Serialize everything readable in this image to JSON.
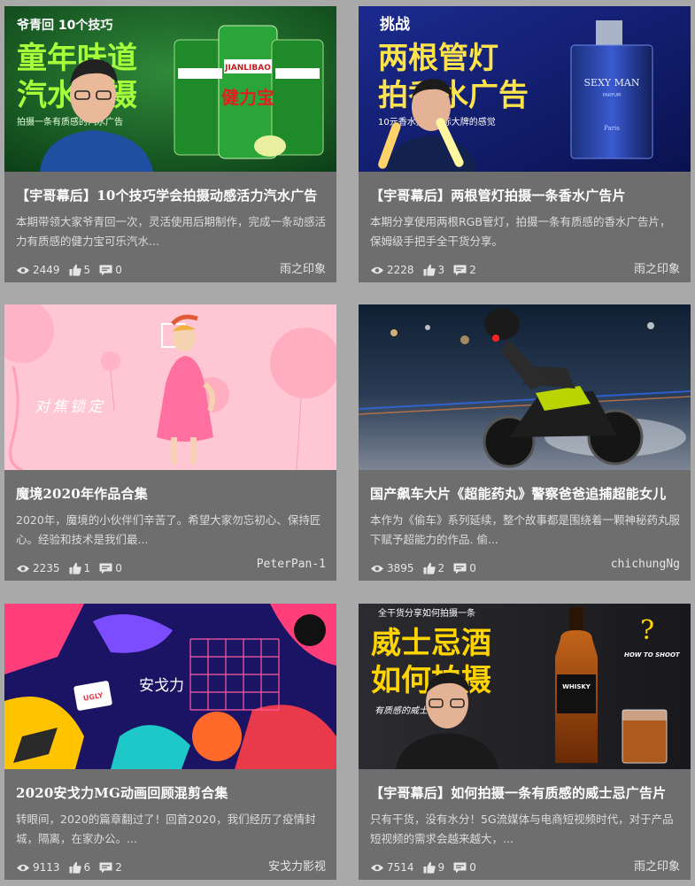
{
  "cards": [
    {
      "title": "【宇哥幕后】10个技巧学会拍摄动感活力汽水广告",
      "desc": "本期带领大家爷青回一次，灵活使用后期制作，完成一条动感活力有质感的健力宝可乐汽水...",
      "views": "2449",
      "likes": "5",
      "comments": "0",
      "author": "雨之印象",
      "thumb": {
        "top": "爷青回  10个技巧",
        "line1": "童年味道",
        "line2": "汽水拍摄",
        "sub": "拍摄一条有质感的汽水广告",
        "brand": "JIANLIBAO",
        "brand_cn": "健力宝"
      }
    },
    {
      "title": "【宇哥幕后】两根管灯拍摄一条香水广告片",
      "desc": "本期分享使用两根RGB管灯，拍摄一条有质感的香水广告片，保姆级手把手全干货分享。",
      "views": "2228",
      "likes": "3",
      "comments": "2",
      "author": "雨之印象",
      "thumb": {
        "top": "挑战",
        "line1": "两根管灯",
        "line2": "拍香水广告",
        "sub": "10元香水拍出国际大牌的感觉",
        "brand": "SEXY MAN",
        "brand_sub": "PARFUM",
        "brand_city": "Paris"
      }
    },
    {
      "title": "魔境2020年作品合集",
      "desc": "2020年，魔境的小伙伴们辛苦了。希望大家勿忘初心、保持匠心。经验和技术是我们最...",
      "views": "2235",
      "likes": "1",
      "comments": "0",
      "author": "PeterPan-1",
      "thumb": {
        "caption": "对焦锁定"
      }
    },
    {
      "title": "国产飙车大片《超能药丸》警察爸爸追捕超能女儿",
      "desc": "本作为《偷车》系列延续，整个故事都是围绕着一颗神秘药丸服下赋予超能力的作品. 偷...",
      "views": "3895",
      "likes": "2",
      "comments": "0",
      "author": "chichungNg",
      "thumb": {}
    },
    {
      "title": "2020安戈力MG动画回顾混剪合集",
      "desc": "转眼间，2020的篇章翻过了！回首2020，我们经历了疫情封城，隔离，在家办公。...",
      "views": "9113",
      "likes": "6",
      "comments": "2",
      "author": "安戈力影视",
      "thumb": {
        "logo": "安戈力",
        "tag": "UGLY"
      }
    },
    {
      "title": "【宇哥幕后】如何拍摄一条有质感的威士忌广告片",
      "desc": "只有干货，没有水分！5G流媒体与电商短视频时代，对于产品短视频的需求会越来越大，...",
      "views": "7514",
      "likes": "9",
      "comments": "0",
      "author": "雨之印象",
      "thumb": {
        "top": "全干货分享如何拍摄一条",
        "line1": "威士忌酒",
        "line2": "如何拍摄",
        "sub": "有质感的威士忌广告片",
        "side": "HOW TO SHOOT",
        "brand": "WHISKY"
      }
    }
  ],
  "icons": {
    "views": "eye-icon",
    "likes": "thumbs-up-icon",
    "comments": "comment-icon"
  }
}
